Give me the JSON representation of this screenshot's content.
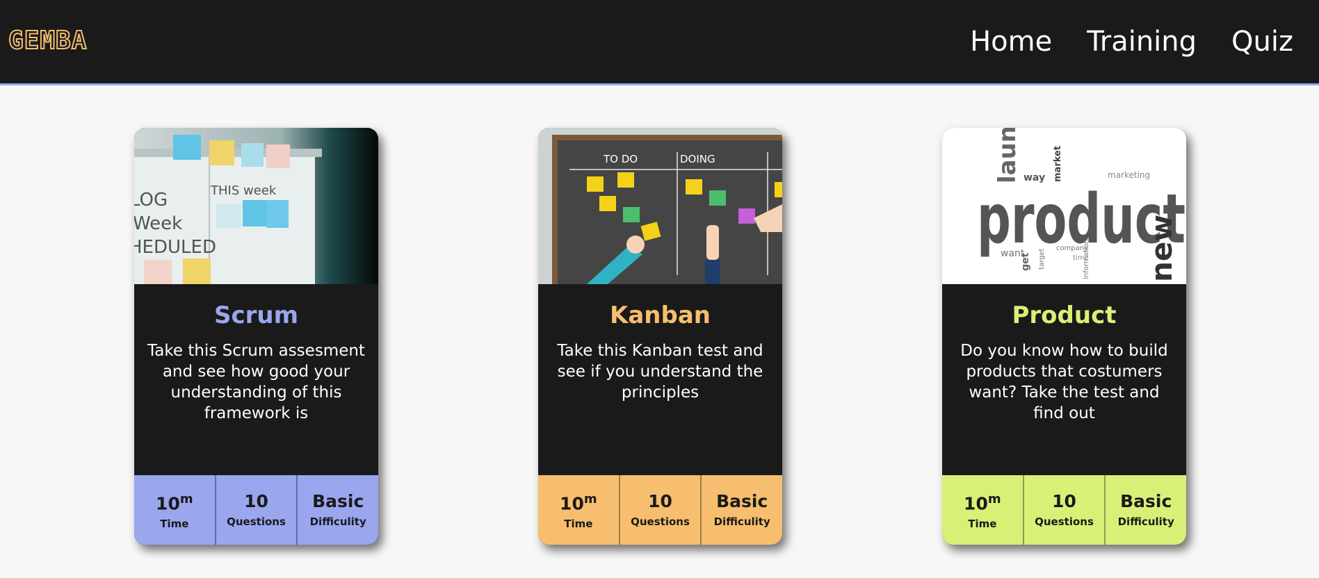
{
  "header": {
    "logo": "GEMBA",
    "nav": [
      "Home",
      "Training",
      "Quiz"
    ]
  },
  "cards": [
    {
      "title": "Scrum",
      "accent": "#9aa6ee",
      "description": "Take this Scrum assesment and see how good your understanding of this framework is",
      "image_alt": "Whiteboard with sticky notes",
      "time_value": "10",
      "time_unit": "m",
      "time_label": "Time",
      "questions_value": "10",
      "questions_label": "Questions",
      "difficulty_value": "Basic",
      "difficulty_label": "Difficulity"
    },
    {
      "title": "Kanban",
      "accent": "#f6be6e",
      "description": "Take this Kanban test and see if you understand the principles",
      "image_alt": "Kanban board illustration",
      "image_labels": [
        "TO DO",
        "DOING"
      ],
      "time_value": "10",
      "time_unit": "m",
      "time_label": "Time",
      "questions_value": "10",
      "questions_label": "Questions",
      "difficulty_value": "Basic",
      "difficulty_label": "Difficulity"
    },
    {
      "title": "Product",
      "accent": "#d9f077",
      "description": "Do you know how to build products that costumers want? Take the test and find out",
      "image_alt": "Product word cloud",
      "image_words": [
        "product",
        "launch",
        "new",
        "market",
        "marketing",
        "way",
        "want",
        "get",
        "company",
        "target",
        "information",
        "time"
      ],
      "time_value": "10",
      "time_unit": "m",
      "time_label": "Time",
      "questions_value": "10",
      "questions_label": "Questions",
      "difficulty_value": "Basic",
      "difficulty_label": "Difficulity"
    }
  ]
}
